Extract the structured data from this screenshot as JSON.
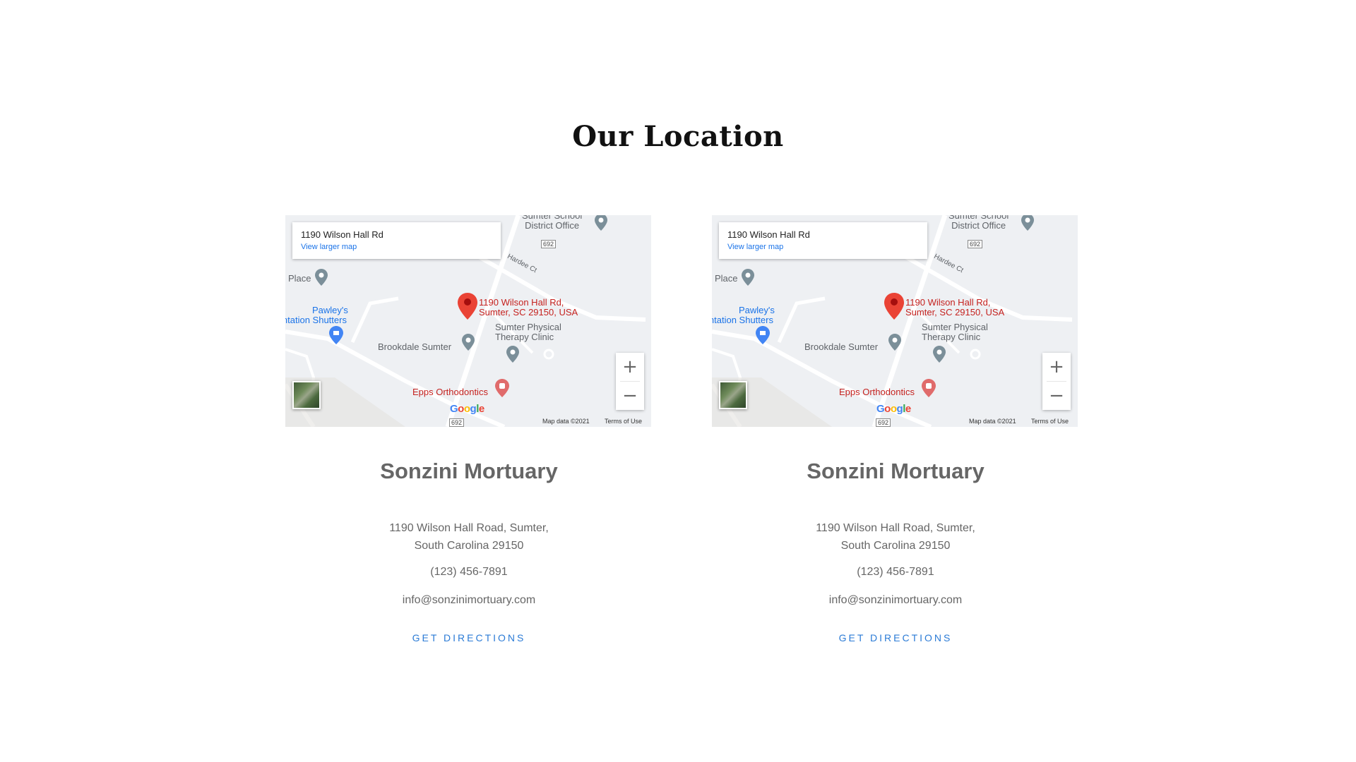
{
  "section": {
    "title": "Our Location"
  },
  "locations": [
    {
      "map": {
        "info_title": "1190 Wilson Hall Rd",
        "info_link": "View larger map",
        "labels": {
          "district_office_line1": "Sumter School",
          "district_office_line2": "District Office",
          "place": "Place",
          "pawleys_line1": "Pawley's",
          "pawleys_line2": "ntation Shutters",
          "marker_line1": "1190 Wilson Hall Rd,",
          "marker_line2": "Sumter, SC 29150, USA",
          "brookdale": "Brookdale Sumter",
          "therapy_line1": "Sumter Physical",
          "therapy_line2": "Therapy Clinic",
          "epps": "Epps Orthodontics",
          "hardee": "Hardee Ct",
          "route": "692"
        },
        "zoom_in": "+",
        "zoom_out": "−",
        "google": "Google",
        "map_data": "Map data ©2021",
        "terms": "Terms of Use"
      },
      "name": "Sonzini Mortuary",
      "address_line1": "1190 Wilson Hall Road, Sumter,",
      "address_line2": "South Carolina 29150",
      "phone": "(123) 456-7891",
      "email": "info@sonzinimortuary.com",
      "directions": "GET DIRECTIONS"
    },
    {
      "map": {
        "info_title": "1190 Wilson Hall Rd",
        "info_link": "View larger map",
        "labels": {
          "district_office_line1": "Sumter School",
          "district_office_line2": "District Office",
          "place": "Place",
          "pawleys_line1": "Pawley's",
          "pawleys_line2": "ntation Shutters",
          "marker_line1": "1190 Wilson Hall Rd,",
          "marker_line2": "Sumter, SC 29150, USA",
          "brookdale": "Brookdale Sumter",
          "therapy_line1": "Sumter Physical",
          "therapy_line2": "Therapy Clinic",
          "epps": "Epps Orthodontics",
          "hardee": "Hardee Ct",
          "route": "692"
        },
        "zoom_in": "+",
        "zoom_out": "−",
        "google": "Google",
        "map_data": "Map data ©2021",
        "terms": "Terms of Use"
      },
      "name": "Sonzini Mortuary",
      "address_line1": "1190 Wilson Hall Road, Sumter,",
      "address_line2": "South Carolina 29150",
      "phone": "(123) 456-7891",
      "email": "info@sonzinimortuary.com",
      "directions": "GET DIRECTIONS"
    }
  ],
  "colors": {
    "accent_link": "#2b7bd6",
    "marker_red": "#ea4335",
    "map_background": "#eef0f3"
  },
  "icons": [
    "map-pin-icon",
    "location-marker-icon",
    "store-pin-icon",
    "dental-pin-icon",
    "zoom-in-icon",
    "zoom-out-icon",
    "satellite-view-icon"
  ]
}
